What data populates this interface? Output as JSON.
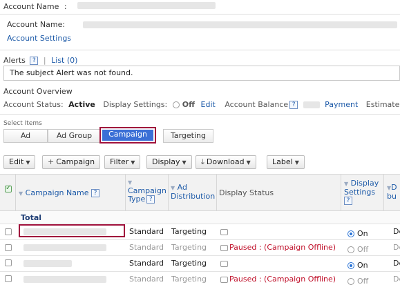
{
  "header": {
    "account_name_label": "Account Name",
    "sep": ":"
  },
  "account_info": {
    "name_label": "Account Name:",
    "settings_link": "Account Settings"
  },
  "alerts": {
    "label": "Alerts",
    "help": "?",
    "divider": "|",
    "list_link": "List (0)",
    "message": "The subject Alert was not found."
  },
  "overview": {
    "title": "Account Overview",
    "status_label": "Account Status:",
    "status_value": "Active",
    "display_settings_label": "Display Settings:",
    "display_settings_value": "Off",
    "edit_link": "Edit",
    "balance_label": "Account Balance",
    "payment_link": "Payment",
    "estimated_label": "Estimated F"
  },
  "select_items": {
    "label": "Select Items",
    "tabs": [
      "Ad",
      "Ad Group",
      "Campaign",
      "Targeting"
    ]
  },
  "toolbar": {
    "edit": "Edit",
    "add_campaign": "Campaign",
    "add_prefix": "+",
    "filter": "Filter",
    "display": "Display",
    "download": "Download",
    "label": "Label"
  },
  "table": {
    "headers": {
      "campaign_name": "Campaign Name",
      "campaign_type_1": "Campaign",
      "campaign_type_2": "Type",
      "ad_distribution_1": "Ad",
      "ad_distribution_2": "Distribution",
      "display_status": "Display Status",
      "display_settings_1": "Display",
      "display_settings_2": "Settings",
      "daily_budget_1": "D",
      "daily_budget_2": "bu"
    },
    "total_label": "Total",
    "rows": [
      {
        "type": "Standard",
        "distribution": "Targeting",
        "status": "",
        "setting": "On",
        "budget": "De"
      },
      {
        "type": "Standard",
        "distribution": "Targeting",
        "status": "Paused : (Campaign Offline)",
        "setting": "Off",
        "budget": "De"
      },
      {
        "type": "Standard",
        "distribution": "Targeting",
        "status": "",
        "setting": "On",
        "budget": "De"
      },
      {
        "type": "Standard",
        "distribution": "Targeting",
        "status": "Paused : (Campaign Offline)",
        "setting": "Off",
        "budget": "De"
      }
    ]
  }
}
